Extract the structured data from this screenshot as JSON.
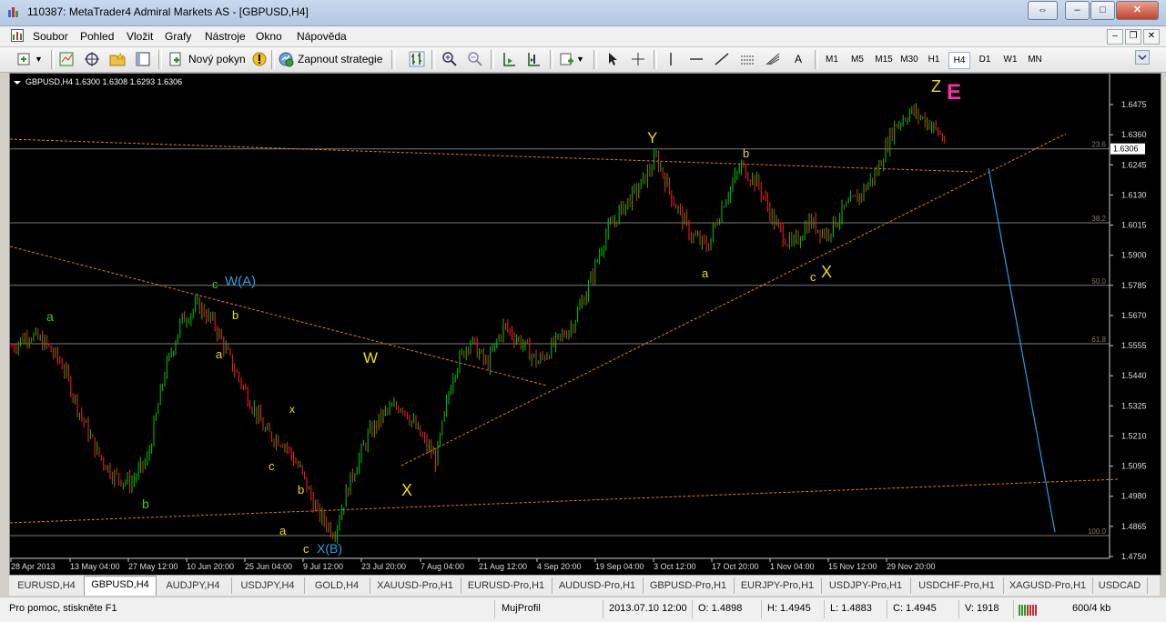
{
  "window": {
    "title": "110387: MetaTrader4 Admiral Markets AS - [GBPUSD,H4]",
    "controls": [
      "⇔",
      "–",
      "□",
      "✕"
    ]
  },
  "menu": [
    "Soubor",
    "Pohled",
    "Vložit",
    "Grafy",
    "Nástroje",
    "Okno",
    "Nápověda"
  ],
  "toolbar": {
    "new_order": "Nový pokyn",
    "autotrading": "Zapnout strategie",
    "draw_text": "A",
    "timeframes": [
      "M1",
      "M5",
      "M15",
      "M30",
      "H1",
      "H4",
      "D1",
      "W1",
      "MN"
    ],
    "active_timeframe": "H4"
  },
  "chart": {
    "header": "GBPUSD,H4  1.6300 1.6308 1.6293 1.6306",
    "current_price": "1.6306",
    "colors": {
      "bg": "#000000",
      "up": "#00c800",
      "down": "#ff2020",
      "grid": "#7a7a7a",
      "fib": "#8a7a6a",
      "trend": "#e07a30",
      "yellow": "#e8e000",
      "green": "#44cc00",
      "blue": "#2a9ee8",
      "magenta": "#ff2db0"
    },
    "y_axis": [
      "1.6475",
      "1.6360",
      "1.6245",
      "1.6130",
      "1.6015",
      "1.5900",
      "1.5785",
      "1.5670",
      "1.5555",
      "1.5440",
      "1.5325",
      "1.5210",
      "1.5095",
      "1.4980",
      "1.4865",
      "1.4750"
    ],
    "x_axis": [
      "28 Apr 2013",
      "13 May 04:00",
      "27 May 12:00",
      "10 Jun 20:00",
      "25 Jun 04:00",
      "9 Jul 12:00",
      "23 Jul 20:00",
      "7 Aug 04:00",
      "21 Aug 12:00",
      "4 Sep 20:00",
      "19 Sep 04:00",
      "3 Oct 12:00",
      "17 Oct 20:00",
      "1 Nov 04:00",
      "15 Nov 12:00",
      "29 Nov 20:00"
    ],
    "fib_levels": [
      {
        "label": "23.6",
        "price": 1.6306
      },
      {
        "label": "38.2",
        "price": 1.6024
      },
      {
        "label": "50.0",
        "price": 1.5785
      },
      {
        "label": "61.8",
        "price": 1.5562
      },
      {
        "label": "100.0",
        "price": 1.483
      }
    ],
    "wave_labels": [
      {
        "text": "a",
        "color": "green"
      },
      {
        "text": "b",
        "color": "green"
      },
      {
        "text": "c",
        "color": "green"
      },
      {
        "text": "W(A)",
        "color": "blue"
      },
      {
        "text": "b",
        "color": "yellow"
      },
      {
        "text": "a",
        "color": "yellow"
      },
      {
        "text": "x",
        "color": "yellow"
      },
      {
        "text": "c",
        "color": "yellow"
      },
      {
        "text": "b",
        "color": "yellow"
      },
      {
        "text": "a",
        "color": "yellow"
      },
      {
        "text": "c",
        "color": "yellow"
      },
      {
        "text": "X(B)",
        "color": "blue"
      },
      {
        "text": "W",
        "color": "yellow"
      },
      {
        "text": "X",
        "color": "yellow"
      },
      {
        "text": "Y",
        "color": "yellow"
      },
      {
        "text": "a",
        "color": "yellow"
      },
      {
        "text": "b",
        "color": "yellow"
      },
      {
        "text": "c",
        "color": "yellow"
      },
      {
        "text": "X",
        "color": "yellow"
      },
      {
        "text": "Z",
        "color": "yellow"
      },
      {
        "text": "E",
        "color": "magenta"
      }
    ],
    "price_path": [
      1.555,
      1.56,
      1.556,
      1.548,
      1.53,
      1.515,
      1.506,
      1.503,
      1.512,
      1.545,
      1.565,
      1.571,
      1.563,
      1.548,
      1.535,
      1.522,
      1.519,
      1.508,
      1.492,
      1.484,
      1.505,
      1.521,
      1.53,
      1.533,
      1.522,
      1.512,
      1.545,
      1.558,
      1.548,
      1.563,
      1.557,
      1.549,
      1.556,
      1.563,
      1.578,
      1.598,
      1.608,
      1.616,
      1.627,
      1.611,
      1.598,
      1.593,
      1.611,
      1.624,
      1.617,
      1.602,
      1.593,
      1.603,
      1.598,
      1.607,
      1.613,
      1.622,
      1.639,
      1.645,
      1.641,
      1.634
    ]
  },
  "tabs": [
    "EURUSD,H4",
    "GBPUSD,H4",
    "AUDJPY,H4",
    "USDJPY,H4",
    "GOLD,H4",
    "XAUUSD-Pro,H1",
    "EURUSD-Pro,H1",
    "AUDUSD-Pro,H1",
    "GBPUSD-Pro,H1",
    "EURJPY-Pro,H1",
    "USDJPY-Pro,H1",
    "USDCHF-Pro,H1",
    "XAGUSD-Pro,H1",
    "USDCAD"
  ],
  "active_tab": "GBPUSD,H4",
  "status": {
    "help": "Pro pomoc, stiskněte F1",
    "profile": "MujProfil",
    "time": "2013.07.10 12:00",
    "open": "O: 1.4898",
    "high": "H: 1.4945",
    "low": "L: 1.4883",
    "close": "C: 1.4945",
    "volume": "V: 1918",
    "traffic": "600/4 kb"
  }
}
